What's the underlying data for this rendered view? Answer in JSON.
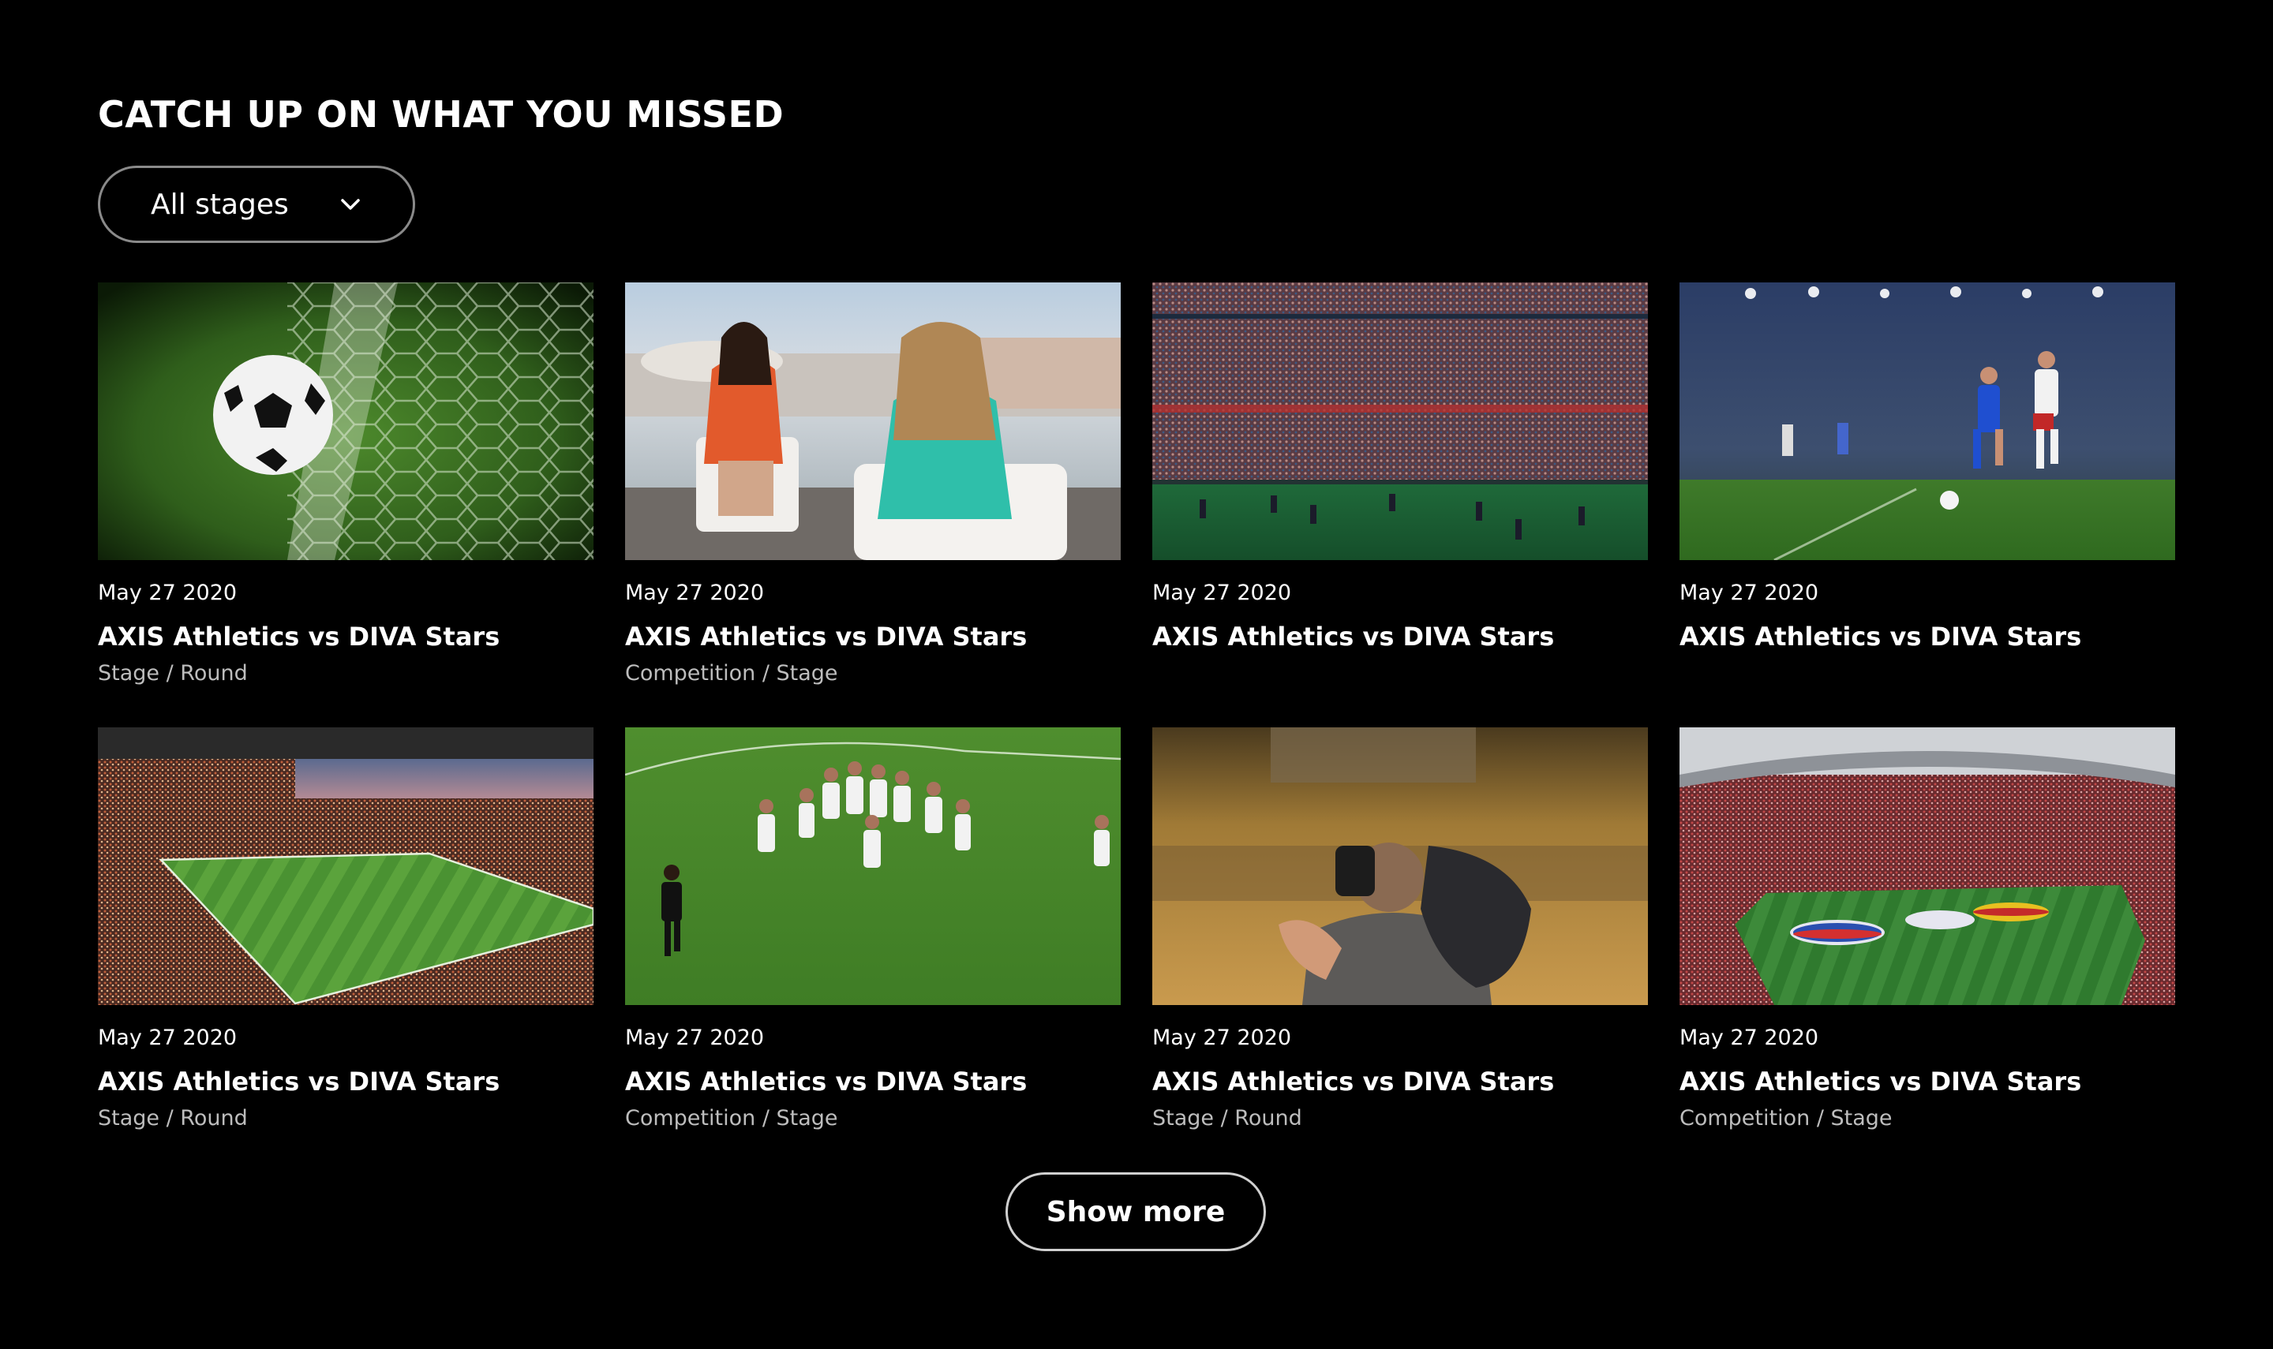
{
  "section": {
    "title": "CATCH UP ON WHAT YOU MISSED"
  },
  "filter": {
    "selected": "All stages",
    "icon": "chevron-down-icon"
  },
  "videos": [
    {
      "date": "May 27 2020",
      "title": "AXIS Athletics vs DIVA Stars",
      "subtitle": "Stage / Round",
      "thumbnail": "ball-in-net"
    },
    {
      "date": "May 27 2020",
      "title": "AXIS Athletics vs DIVA Stars",
      "subtitle": "Competition / Stage",
      "thumbnail": "studio-interview"
    },
    {
      "date": "May 27 2020",
      "title": "AXIS Athletics vs DIVA Stars",
      "subtitle": "",
      "thumbnail": "stadium-crowd"
    },
    {
      "date": "May 27 2020",
      "title": "AXIS Athletics vs DIVA Stars",
      "subtitle": "",
      "thumbnail": "players-dribbling"
    },
    {
      "date": "May 27 2020",
      "title": "AXIS Athletics vs DIVA Stars",
      "subtitle": "Stage / Round",
      "thumbnail": "stadium-pitch-dusk"
    },
    {
      "date": "May 27 2020",
      "title": "AXIS Athletics vs DIVA Stars",
      "subtitle": "Competition / Stage",
      "thumbnail": "team-celebration"
    },
    {
      "date": "May 27 2020",
      "title": "AXIS Athletics vs DIVA Stars",
      "subtitle": "Stage / Round",
      "thumbnail": "cameraman"
    },
    {
      "date": "May 27 2020",
      "title": "AXIS Athletics vs DIVA Stars",
      "subtitle": "Competition / Stage",
      "thumbnail": "stadium-flags"
    }
  ],
  "show_more": {
    "label": "Show more"
  }
}
